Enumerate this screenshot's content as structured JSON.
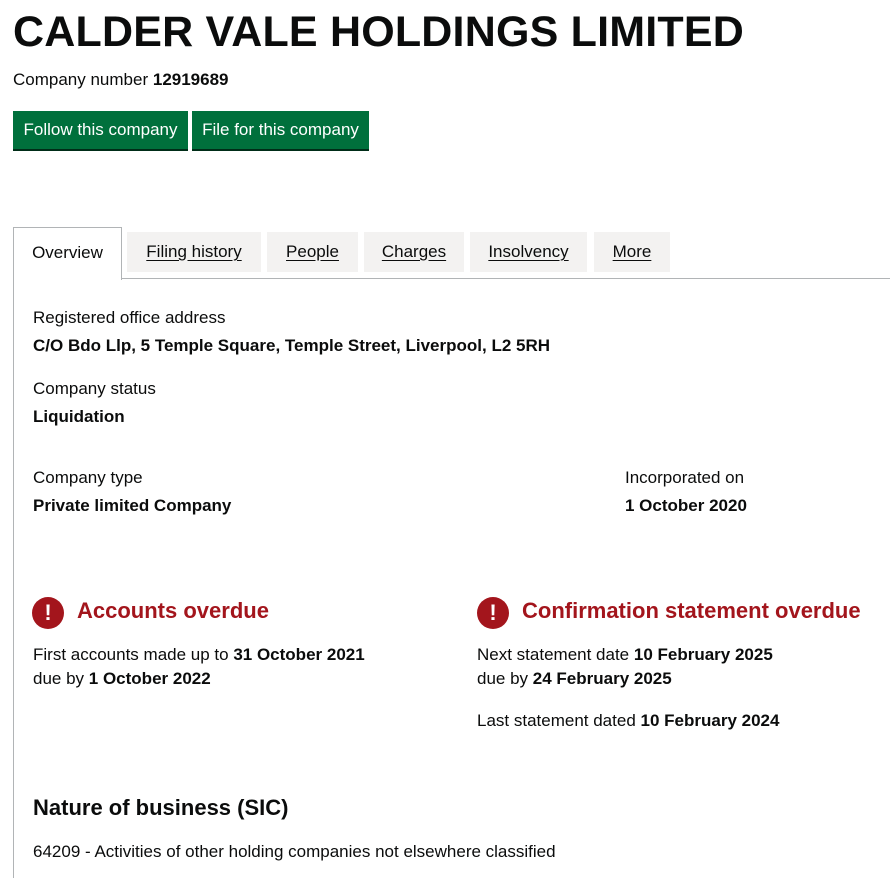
{
  "company": {
    "name": "CALDER VALE HOLDINGS LIMITED",
    "number_label": "Company number",
    "number": "12919689"
  },
  "actions": {
    "follow": "Follow this company",
    "file": "File for this company"
  },
  "tabs": [
    {
      "label": "Overview",
      "active": true
    },
    {
      "label": "Filing history",
      "active": false
    },
    {
      "label": "People",
      "active": false
    },
    {
      "label": "Charges",
      "active": false
    },
    {
      "label": "Insolvency",
      "active": false
    },
    {
      "label": "More",
      "active": false
    }
  ],
  "overview": {
    "registered_office": {
      "label": "Registered office address",
      "value": "C/O Bdo Llp, 5 Temple Square, Temple Street, Liverpool, L2 5RH"
    },
    "status": {
      "label": "Company status",
      "value": "Liquidation"
    },
    "type": {
      "label": "Company type",
      "value": "Private limited Company"
    },
    "incorporated": {
      "label": "Incorporated on",
      "value": "1 October 2020"
    }
  },
  "accounts": {
    "heading": "Accounts overdue",
    "line1_prefix": "First accounts made up to",
    "line1_date": "31 October 2021",
    "line2_prefix": "due by",
    "line2_date": "1 October 2022"
  },
  "confirmation": {
    "heading": "Confirmation statement overdue",
    "line1_prefix": "Next statement date",
    "line1_date": "10 February 2025",
    "line2_prefix": "due by",
    "line2_date": "24 February 2025",
    "line3_prefix": "Last statement dated",
    "line3_date": "10 February 2024"
  },
  "nature_of_business": {
    "heading": "Nature of business (SIC)",
    "items": [
      "64209 - Activities of other holding companies not elsewhere classified"
    ]
  },
  "icons": {
    "warning": "exclamation-icon"
  },
  "colors": {
    "button": "#00703c",
    "warning": "#a3151c",
    "tab_background": "#f3f2f1"
  }
}
